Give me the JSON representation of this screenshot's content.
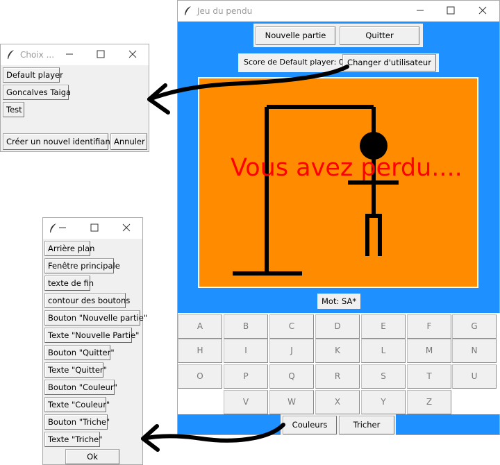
{
  "main": {
    "title": "Jeu du pendu",
    "new_game_label": "Nouvelle partie",
    "quit_label": "Quitter",
    "score_text": "Score de Default player: 0",
    "change_user_label": "Changer d'utilisateur",
    "lose_message": "Vous avez perdu....",
    "word_text": "Mot: SA*",
    "keys": [
      "A",
      "B",
      "C",
      "D",
      "E",
      "F",
      "G",
      "H",
      "I",
      "J",
      "K",
      "L",
      "M",
      "N",
      "O",
      "P",
      "Q",
      "R",
      "S",
      "T",
      "U",
      "V",
      "W",
      "X",
      "Y",
      "Z"
    ],
    "colors_label": "Couleurs",
    "cheat_label": "Tricher"
  },
  "choose": {
    "title": "Choix ...",
    "users": [
      "Default player",
      "Goncalves Taiga",
      "Test"
    ],
    "create_label": "Créer un nouvel identifiant",
    "cancel_label": "Annuler"
  },
  "colors_win": {
    "title": "",
    "items": [
      "Arrière plan",
      "Fenêtre principale",
      "texte de fin",
      "contour des boutons",
      "Bouton \"Nouvelle partie\"",
      "Texte \"Nouvelle Partie\"",
      "Bouton \"Quitter\"",
      "Texte \"Quitter\"",
      "Bouton \"Couleur\"",
      "Texte \"Couleur\"",
      "Bouton \"Triche\"",
      "Texte \"Triche\""
    ],
    "ok_label": "Ok"
  },
  "palette": {
    "main_bg": "#1e90ff",
    "canvas_bg": "#ff8c00",
    "lose_text": "#ff0000",
    "gallows": "#000000"
  }
}
